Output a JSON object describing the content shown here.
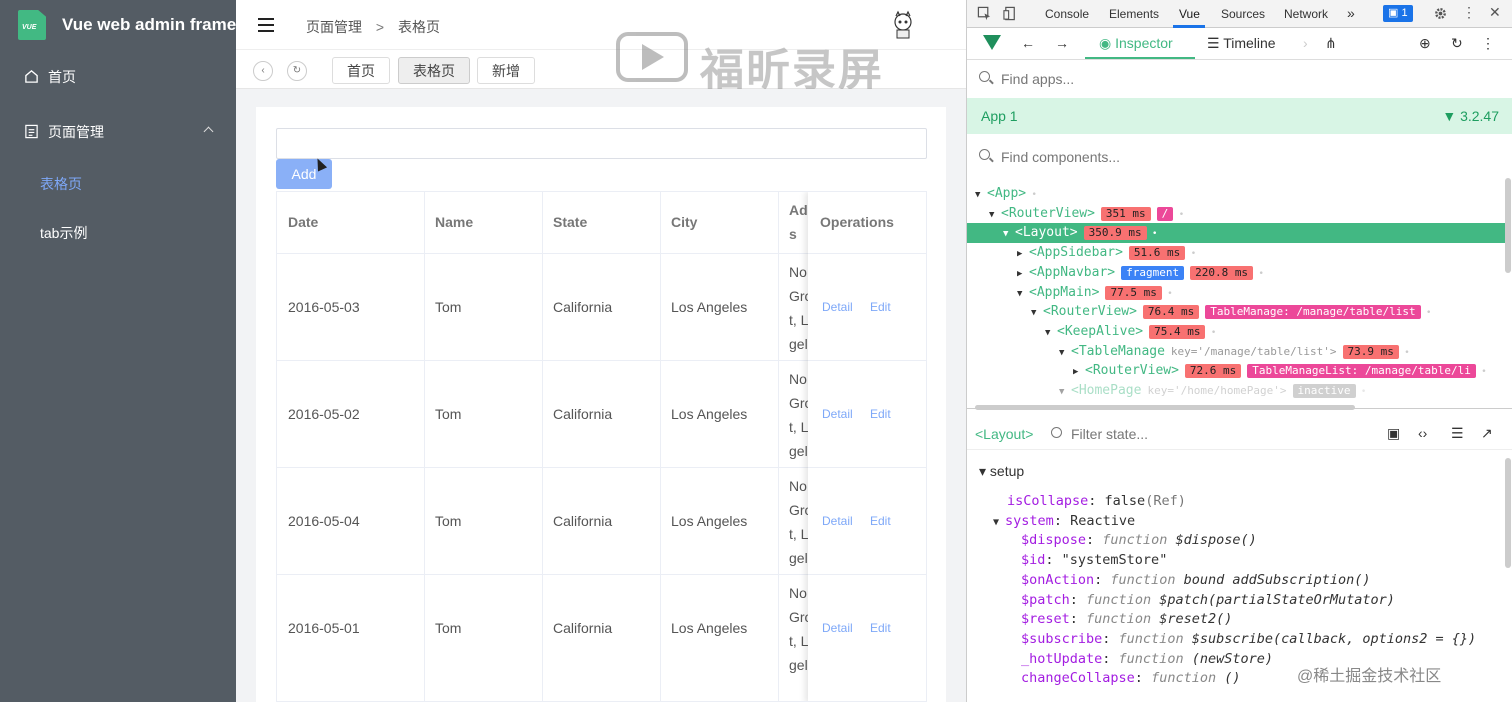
{
  "app": {
    "title": "Vue web admin frame",
    "logo_text": "VUE"
  },
  "sidebar": {
    "items": [
      {
        "label": "首页",
        "icon": "home-icon"
      },
      {
        "label": "页面管理",
        "icon": "document-icon"
      }
    ],
    "sub_items": [
      {
        "label": "表格页",
        "active": true
      },
      {
        "label": "tab示例",
        "active": false
      }
    ]
  },
  "navbar": {
    "breadcrumb": [
      "页面管理",
      ">",
      "表格页"
    ]
  },
  "tags": [
    "首页",
    "表格页",
    "新增"
  ],
  "watermark": "福昕录屏",
  "toolbar": {
    "add_label": "Add",
    "search_value": ""
  },
  "table": {
    "columns": [
      "Date",
      "Name",
      "State",
      "City",
      "Address",
      "Operations"
    ],
    "address_header_visible": [
      "Add",
      "s"
    ],
    "address_fragments": [
      "No.",
      "Gro",
      "t, L",
      "gel"
    ],
    "rows": [
      {
        "date": "2016-05-03",
        "name": "Tom",
        "state": "California",
        "city": "Los Angeles"
      },
      {
        "date": "2016-05-02",
        "name": "Tom",
        "state": "California",
        "city": "Los Angeles"
      },
      {
        "date": "2016-05-04",
        "name": "Tom",
        "state": "California",
        "city": "Los Angeles"
      },
      {
        "date": "2016-05-01",
        "name": "Tom",
        "state": "California",
        "city": "Los Angeles"
      }
    ],
    "op_detail": "Detail",
    "op_edit": "Edit"
  },
  "devtools": {
    "tabs": [
      "Console",
      "Elements",
      "Vue",
      "Sources",
      "Network",
      "»"
    ],
    "active_tab": "Vue",
    "issues_count": "1",
    "vue_tabs": [
      "Inspector",
      "Timeline"
    ],
    "find_apps_placeholder": "Find apps...",
    "app_name": "App 1",
    "vue_version": "3.2.47",
    "find_components_placeholder": "Find components...",
    "tree": [
      {
        "arrow": "▼",
        "name": "<App>",
        "badges": []
      },
      {
        "arrow": "▼",
        "name": "<RouterView>",
        "badges": [
          {
            "t": "351 ms",
            "c": "red"
          },
          {
            "t": "/",
            "c": "pink"
          }
        ]
      },
      {
        "arrow": "▼",
        "name": "<Layout>",
        "badges": [
          {
            "t": "350.9 ms",
            "c": "red"
          }
        ],
        "selected": true
      },
      {
        "arrow": "▶",
        "name": "<AppSidebar>",
        "badges": [
          {
            "t": "51.6 ms",
            "c": "red"
          }
        ]
      },
      {
        "arrow": "▶",
        "name": "<AppNavbar>",
        "badges": [
          {
            "t": "fragment",
            "c": "blue"
          },
          {
            "t": "220.8 ms",
            "c": "red"
          }
        ]
      },
      {
        "arrow": "▼",
        "name": "<AppMain>",
        "badges": [
          {
            "t": "77.5 ms",
            "c": "red"
          }
        ]
      },
      {
        "arrow": "▼",
        "name": "<RouterView>",
        "badges": [
          {
            "t": "76.4 ms",
            "c": "red"
          },
          {
            "t": "TableManage: /manage/table/list",
            "c": "pink"
          }
        ]
      },
      {
        "arrow": "▼",
        "name": "<KeepAlive>",
        "badges": [
          {
            "t": "75.4 ms",
            "c": "red"
          }
        ]
      },
      {
        "arrow": "▼",
        "name": "<TableManage",
        "key": "key='/manage/table/list'>",
        "badges": [
          {
            "t": "73.9 ms",
            "c": "red"
          }
        ]
      },
      {
        "arrow": "▶",
        "name": "<RouterView>",
        "badges": [
          {
            "t": "72.6 ms",
            "c": "red"
          },
          {
            "t": "TableManageList: /manage/table/li",
            "c": "pink"
          }
        ]
      },
      {
        "arrow": "▼",
        "name": "<HomePage",
        "key": "key='/home/homePage'>",
        "badges": [
          {
            "t": "inactive",
            "c": "gray"
          }
        ],
        "faded": true
      }
    ],
    "state_component": "<Layout>",
    "filter_placeholder": "Filter state...",
    "state": {
      "section": "setup",
      "lines": [
        {
          "key": "isCollapse",
          "value": "false",
          "extra": "(Ref)"
        },
        {
          "key": "system",
          "value": "Reactive",
          "expandable": true
        },
        {
          "key": "$dispose",
          "fn": "function",
          "sig": "$dispose()"
        },
        {
          "key": "$id",
          "value": "\"systemStore\""
        },
        {
          "key": "$onAction",
          "fn": "function",
          "sig": "bound addSubscription()"
        },
        {
          "key": "$patch",
          "fn": "function",
          "sig": "$patch(partialStateOrMutator)"
        },
        {
          "key": "$reset",
          "fn": "function",
          "sig": "$reset2()"
        },
        {
          "key": "$subscribe",
          "fn": "function",
          "sig": "$subscribe(callback, options2 = {})"
        },
        {
          "key": "_hotUpdate",
          "fn": "function",
          "sig": "(newStore)"
        },
        {
          "key": "changeCollapse",
          "fn": "function",
          "sig": "()"
        }
      ]
    },
    "footer_watermark": "@稀土掘金技术社区"
  },
  "colors": {
    "sidebar_bg": "#545c64",
    "accent": "#7ea8f8",
    "vue_green": "#42b883"
  }
}
